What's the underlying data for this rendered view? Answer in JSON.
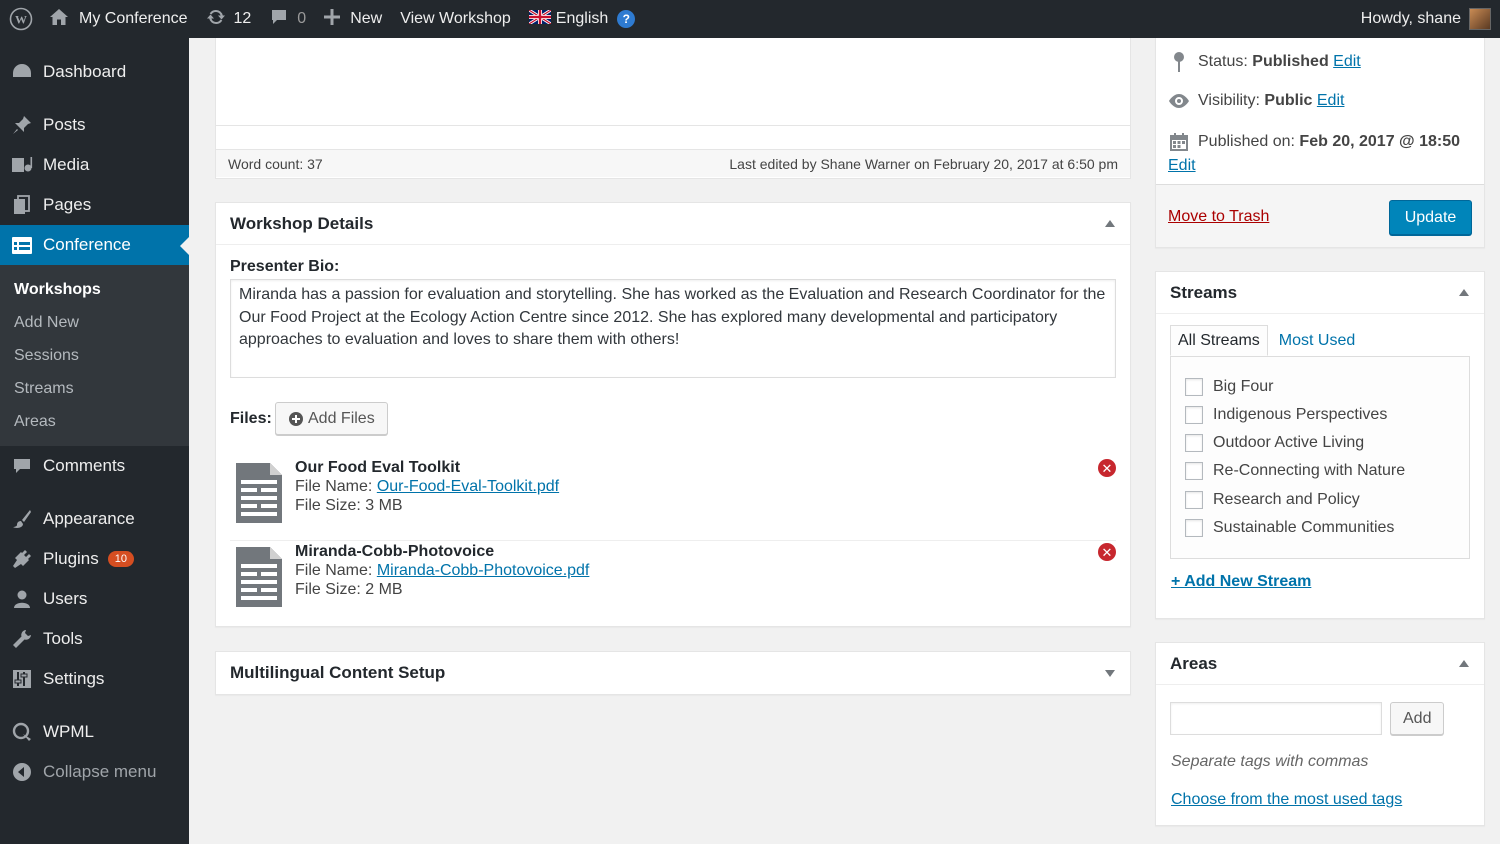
{
  "admin_bar": {
    "site_name": "My Conference",
    "updates_count": "12",
    "comments_count": "0",
    "new_label": "New",
    "view_label": "View Workshop",
    "language_label": "English",
    "greeting": "Howdy, shane"
  },
  "menu": {
    "dashboard": "Dashboard",
    "posts": "Posts",
    "media": "Media",
    "pages": "Pages",
    "conference": "Conference",
    "submenu": [
      "Workshops",
      "Add New",
      "Sessions",
      "Streams",
      "Areas"
    ],
    "comments": "Comments",
    "appearance": "Appearance",
    "plugins": "Plugins",
    "plugins_badge": "10",
    "users": "Users",
    "tools": "Tools",
    "settings": "Settings",
    "wpml": "WPML",
    "collapse": "Collapse menu"
  },
  "editor": {
    "word_count": "Word count: 37",
    "last_edited": "Last edited by Shane Warner on February 20, 2017 at 6:50 pm"
  },
  "workshop_details": {
    "title": "Workshop Details",
    "bio_label": "Presenter Bio:",
    "bio_text": "Miranda has a passion for evaluation and storytelling. She has worked as the Evaluation and Research Coordinator for the Our Food Project at the Ecology Action Centre since 2012. She has explored many developmental and participatory approaches to evaluation and loves to share them with others!",
    "files_label": "Files:",
    "add_files": "Add Files",
    "files": [
      {
        "title": "Our Food Eval Toolkit",
        "name_label": "File Name:",
        "file_name": "Our-Food-Eval-Toolkit.pdf",
        "size": "File Size: 3 MB"
      },
      {
        "title": "Miranda-Cobb-Photovoice",
        "name_label": "File Name:",
        "file_name": "Miranda-Cobb-Photovoice.pdf",
        "size": "File Size: 2 MB"
      }
    ]
  },
  "multilingual": {
    "title": "Multilingual Content Setup"
  },
  "publish": {
    "status_label": "Status:",
    "status_value": "Published",
    "visibility_label": "Visibility:",
    "visibility_value": "Public",
    "published_label": "Published on:",
    "published_value": "Feb 20, 2017 @ 18:50",
    "edit": "Edit",
    "trash": "Move to Trash",
    "update": "Update"
  },
  "streams": {
    "title": "Streams",
    "tab_all": "All Streams",
    "tab_most": "Most Used",
    "items": [
      "Big Four",
      "Indigenous Perspectives",
      "Outdoor Active Living",
      "Re-Connecting with Nature",
      "Research and Policy",
      "Sustainable Communities"
    ],
    "add_new": "+ Add New Stream"
  },
  "areas": {
    "title": "Areas",
    "add_button": "Add",
    "hint": "Separate tags with commas",
    "choose_link": "Choose from the most used tags"
  },
  "colors": {
    "admin_dark": "#23282d",
    "accent": "#0073aa",
    "primary_button": "#0085ba",
    "danger": "#c7272e",
    "badge": "#d54e21"
  }
}
